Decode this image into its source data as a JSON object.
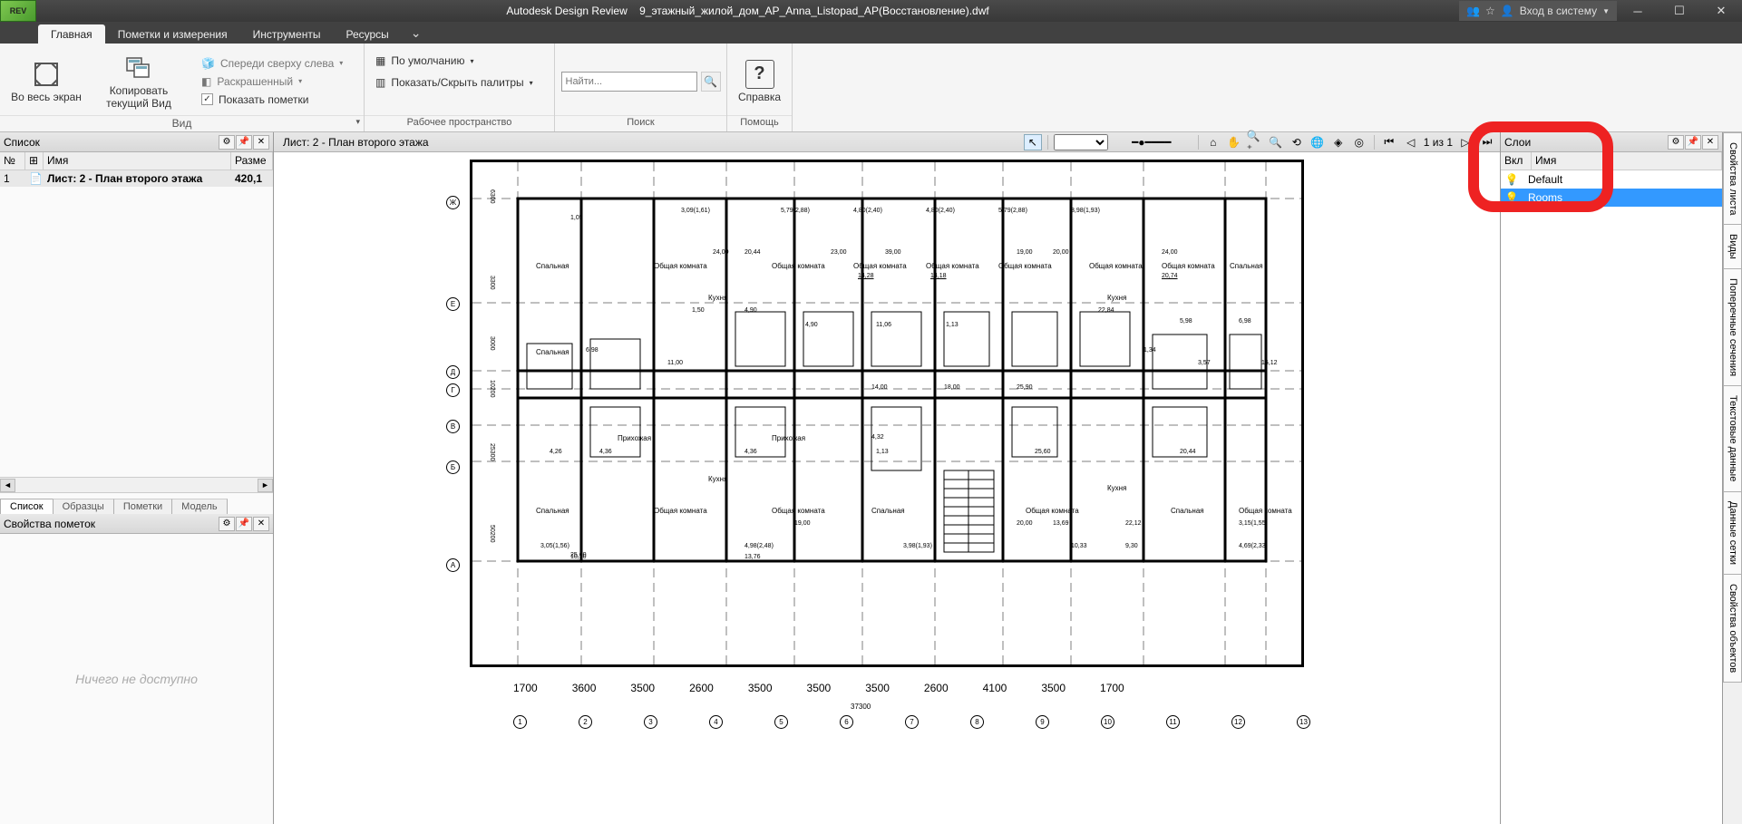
{
  "app": {
    "name": "Autodesk Design Review",
    "document": "9_этажный_жилой_дом_АР_Аnna_Listopad_AP(Восстановление).dwf",
    "logo_text": "REV",
    "login_text": "Вход в систему"
  },
  "menu_tabs": [
    "Главная",
    "Пометки и измерения",
    "Инструменты",
    "Ресурсы"
  ],
  "active_tab": 0,
  "ribbon": {
    "view_group": {
      "label": "Вид",
      "fullscreen": "Во весь экран",
      "copy_view": "Копировать текущий Вид",
      "front_top_left": "Спереди сверху слева",
      "shaded": "Раскрашенный",
      "show_markups": "Показать пометки"
    },
    "workspace_group": {
      "label": "Рабочее пространство",
      "default": "По умолчанию",
      "palettes": "Показать/Скрыть палитры"
    },
    "search_group": {
      "label": "Поиск",
      "placeholder": "Найти..."
    },
    "help_group": {
      "label": "Помощь",
      "help": "Справка"
    }
  },
  "list_panel": {
    "title": "Список",
    "cols": {
      "num": "№",
      "name": "Имя",
      "size": "Разме"
    },
    "row": {
      "num": "1",
      "name": "Лист: 2 - План второго этажа",
      "size": "420,1"
    },
    "bottom_tabs": [
      "Список",
      "Образцы",
      "Пометки",
      "Модель"
    ]
  },
  "markup_panel": {
    "title": "Свойства пометок",
    "empty": "Ничего не доступно"
  },
  "canvas": {
    "sheet": "Лист: 2 - План второго этажа",
    "page": "1 из 1"
  },
  "layers_panel": {
    "title": "Слои",
    "cols": {
      "on": "Вкл",
      "name": "Имя"
    },
    "rows": [
      {
        "name": "Default",
        "selected": false
      },
      {
        "name": "Rooms",
        "selected": true
      }
    ]
  },
  "side_tabs": [
    "Свойства листа",
    "Виды",
    "Поперечные сечения",
    "Текстовые данные",
    "Данные сетки",
    "Свойства объектов"
  ],
  "plan": {
    "grid_letters": [
      "Ж",
      "Е",
      "Д",
      "Г",
      "В",
      "Б",
      "А"
    ],
    "grid_numbers": [
      "1",
      "2",
      "3",
      "4",
      "5",
      "6",
      "7",
      "8",
      "9",
      "10",
      "11",
      "12",
      "13"
    ],
    "total_width": "37300",
    "rooms": [
      "Спальная",
      "Общая комната",
      "Кухня",
      "Прихожая"
    ],
    "dims_top": [
      "3,09(1,61)",
      "5,79(2,88)",
      "4,80(2,40)",
      "4,80(2,40)",
      "5,79(2,88)",
      "3,98(1,93)"
    ],
    "room_area_1": "14,28",
    "room_area_2": "14,18",
    "room_area_3": "20,74",
    "widths": [
      "1700",
      "3600",
      "3500",
      "2600",
      "3500",
      "3500",
      "3500",
      "2600",
      "4100",
      "3500",
      "1700"
    ],
    "h1": "6300",
    "h2": "3300",
    "h3": "3000",
    "h4": "10200",
    "h5": "25300",
    "h6": "50200",
    "top_spans": [
      "24,00",
      "20,44",
      "23,00",
      "39,00",
      "19,00",
      "20,00",
      "24,00"
    ],
    "small_dims": [
      "25,60",
      "1,05",
      "1,50",
      "4,90",
      "4,90",
      "11,06",
      "1,13",
      "22,84",
      "5,98",
      "6,98",
      "6,98",
      "11,00",
      "14,00",
      "18,00",
      "25,90",
      "1,34",
      "3,57",
      "15,12",
      "4,26",
      "4,36",
      "4,36",
      "1,13",
      "25,60",
      "20,44",
      "10,10",
      "13,76",
      "19,00",
      "20,00",
      "13,69",
      "22,12",
      "3,15(1,55)",
      "3,05(1,56)",
      "4,98(2,48)",
      "3,98(1,93)",
      "10,33",
      "9,30",
      "4,69(2,33)",
      "4,32"
    ]
  }
}
